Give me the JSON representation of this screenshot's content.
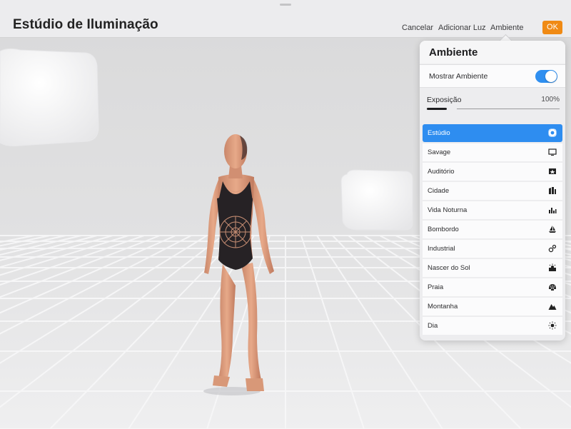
{
  "header": {
    "title": "Estúdio de Iluminação",
    "buttons": {
      "cancel": "Cancelar",
      "add_light": "Adicionar Luz",
      "environment": "Ambiente",
      "ok": "OK"
    },
    "ok_color": "#f08a14"
  },
  "popover": {
    "title": "Ambiente",
    "show_environment": {
      "label": "Mostrar Ambiente",
      "enabled": true
    },
    "exposure": {
      "label": "Exposição",
      "value_text": "100%",
      "level": 1.0
    },
    "accent_color": "#2e8df0",
    "environments": [
      {
        "label": "Estúdio",
        "icon": "studio-icon",
        "selected": true
      },
      {
        "label": "Savage",
        "icon": "monitor-icon",
        "selected": false
      },
      {
        "label": "Auditório",
        "icon": "auditorium-icon",
        "selected": false
      },
      {
        "label": "Cidade",
        "icon": "city-icon",
        "selected": false
      },
      {
        "label": "Vida Noturna",
        "icon": "nightlife-icon",
        "selected": false
      },
      {
        "label": "Bombordo",
        "icon": "sailboat-icon",
        "selected": false
      },
      {
        "label": "Industrial",
        "icon": "gears-icon",
        "selected": false
      },
      {
        "label": "Nascer do Sol",
        "icon": "sunrise-icon",
        "selected": false
      },
      {
        "label": "Praia",
        "icon": "shell-icon",
        "selected": false
      },
      {
        "label": "Montanha",
        "icon": "mountain-icon",
        "selected": false
      },
      {
        "label": "Dia",
        "icon": "sun-icon",
        "selected": false
      }
    ]
  },
  "scene": {
    "objects": [
      "light-box-icon",
      "light-cube-icon",
      "human-figure-model"
    ]
  }
}
